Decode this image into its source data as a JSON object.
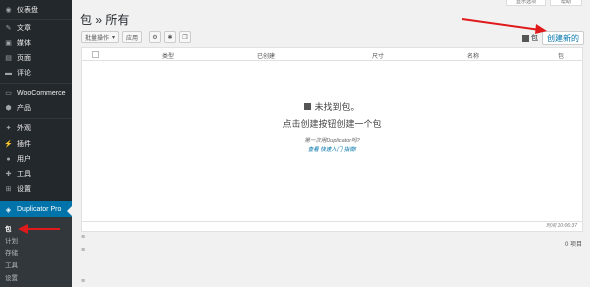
{
  "sidebar": {
    "items": [
      {
        "icon": "dashboard-icon",
        "glyph": "◉",
        "label": "仪表盘"
      },
      {
        "icon": "pin-icon",
        "glyph": "✎",
        "label": "文章"
      },
      {
        "icon": "media-icon",
        "glyph": "▣",
        "label": "媒体"
      },
      {
        "icon": "page-icon",
        "glyph": "▤",
        "label": "页面"
      },
      {
        "icon": "comment-icon",
        "glyph": "▬",
        "label": "评论"
      },
      {
        "icon": "woocommerce-icon",
        "glyph": "▭",
        "label": "WooCommerce"
      },
      {
        "icon": "product-icon",
        "glyph": "⬢",
        "label": "产品"
      },
      {
        "icon": "appearance-icon",
        "glyph": "✦",
        "label": "外观"
      },
      {
        "icon": "plugin-icon",
        "glyph": "⚡",
        "label": "插件"
      },
      {
        "icon": "user-icon",
        "glyph": "●",
        "label": "用户"
      },
      {
        "icon": "tool-icon",
        "glyph": "✚",
        "label": "工具"
      },
      {
        "icon": "settings-icon",
        "glyph": "⊞",
        "label": "设置"
      },
      {
        "icon": "duplicator-icon",
        "glyph": "◈",
        "label": "Duplicator Pro"
      }
    ],
    "submenu": [
      "包",
      "计划",
      "存储",
      "工具",
      "设置"
    ]
  },
  "header": {
    "tab_left": "显示选项",
    "tab_right": "帮助",
    "title": "包 » 所有"
  },
  "toolbar": {
    "bulk_label": "批量操作",
    "bulk_caret": "▾",
    "apply_label": "应用",
    "icon_1": "⚙",
    "icon_2": "✱",
    "icon_3": "❐",
    "packages_label": "包",
    "create_label": "创建新的"
  },
  "table": {
    "columns": [
      "类型",
      "已创建",
      "尺寸",
      "名称",
      "包"
    ],
    "empty_title": "未找到包。",
    "empty_subtitle": "点击创建按钮创建一个包",
    "first_time": "第一次用Duplicator吗?",
    "quick_start": "查看 快速入门 指南!",
    "footer_time": "时间 10:06:37"
  },
  "footer": {
    "items_count": "0 项目"
  },
  "colors": {
    "sidebar_bg": "#23282d",
    "accent": "#0073aa",
    "arrow": "#e0191b"
  }
}
